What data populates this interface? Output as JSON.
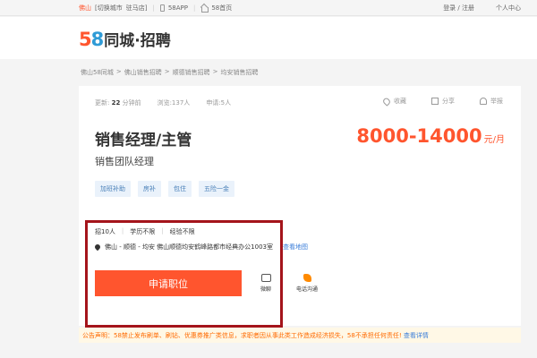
{
  "topbar": {
    "city": "佛山",
    "switch_city": "[切换城市",
    "station": "驻马店]",
    "app": "58APP",
    "home": "58首页",
    "login": "登录 / 注册",
    "user_center": "个人中心"
  },
  "header": {
    "logo_number": "5",
    "logo_number2": "8",
    "logo_brand": "同城·招聘"
  },
  "breadcrumb": [
    "佛山58同城",
    ">",
    "佛山销售招聘",
    ">",
    "顺德销售招聘",
    ">",
    "均安销售招聘"
  ],
  "job": {
    "update_label": "更新:",
    "update_value": "22",
    "update_suffix": "分钟前",
    "views": "浏览:137人",
    "applies": "申请:5人",
    "favorite": "收藏",
    "share": "分享",
    "report": "举报",
    "title": "销售经理/主管",
    "salary": "8000-14000",
    "salary_unit": "元/月",
    "subtitle": "销售团队经理",
    "tags": [
      "加班补助",
      "房补",
      "包住",
      "五险一金"
    ],
    "requirements": [
      "招10人",
      "学历不限",
      "经验不限"
    ],
    "address": "佛山 - 顺德 - 均安   佛山顺德均安鹤峰路都市经典办公1003室",
    "map_link": "查看地图",
    "apply_button": "申请职位",
    "chat_label": "微聊",
    "call_label": "电话沟通"
  },
  "notice": {
    "text": "公告声明：58禁止发布刷单、刷钻、优惠券推广类信息，求职者因从事此类工作造成经济损失，58不承担任何责任!",
    "more": "查看详情"
  },
  "colors": {
    "brand_orange": "#ff552e",
    "highlight_border": "#a4141b",
    "link_blue": "#3b7ed9"
  }
}
